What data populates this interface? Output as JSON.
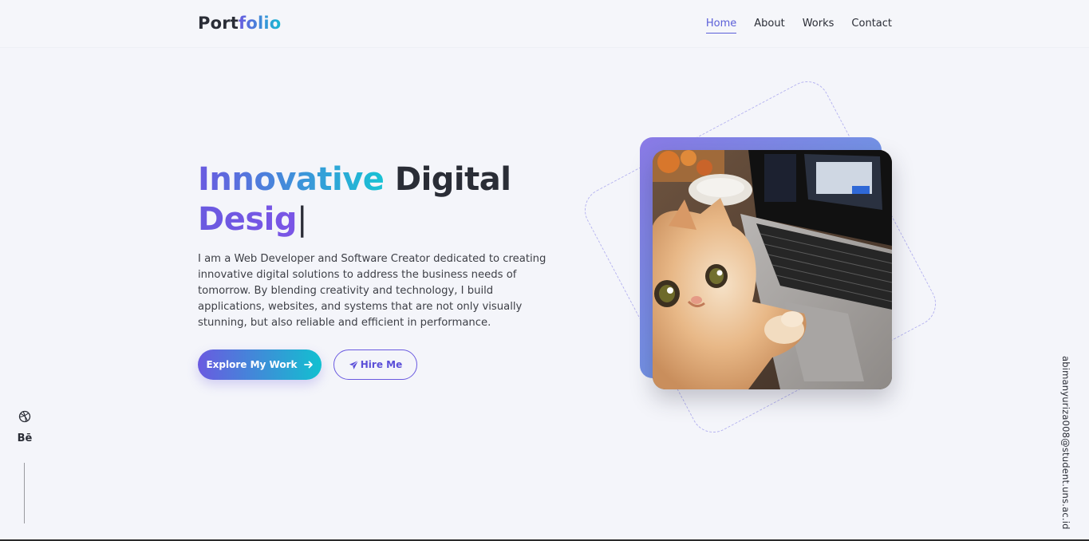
{
  "header": {
    "logo_part1": "Port",
    "logo_part2": "folio",
    "nav": [
      {
        "label": "Home",
        "active": true
      },
      {
        "label": "About",
        "active": false
      },
      {
        "label": "Works",
        "active": false
      },
      {
        "label": "Contact",
        "active": false
      }
    ]
  },
  "hero": {
    "title_word1": "Innovative",
    "title_word2": "Digital",
    "title_line2": "Desig",
    "cursor": "|",
    "description": "I am a Web Developer and Software Creator dedicated to creating innovative digital solutions to address the business needs of tomorrow. By blending creativity and technology, I build applications, websites, and systems that are not only visually stunning, but also reliable and efficient in performance.",
    "primary_button": "Explore My Work",
    "secondary_button": "Hire Me"
  },
  "social": {
    "dribbble_icon": "dribbble-icon",
    "behance_label": "Bē"
  },
  "email": "abimanyuriza008@student.uns.ac.id",
  "colors": {
    "accent_purple": "#6a5ae0",
    "accent_cyan": "#18c2d4",
    "text_dark": "#2a2d36",
    "background": "#f4f5fa"
  }
}
